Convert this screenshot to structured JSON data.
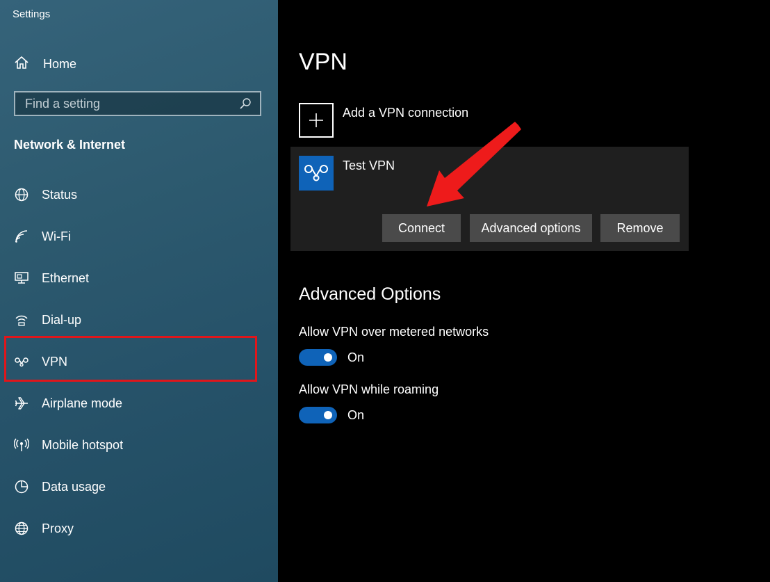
{
  "window": {
    "title": "Settings"
  },
  "sidebar": {
    "home_label": "Home",
    "search": {
      "placeholder": "Find a setting",
      "value": ""
    },
    "section_title": "Network & Internet",
    "items": [
      {
        "label": "Status",
        "icon": "globe-status-icon"
      },
      {
        "label": "Wi-Fi",
        "icon": "wifi-icon"
      },
      {
        "label": "Ethernet",
        "icon": "ethernet-icon"
      },
      {
        "label": "Dial-up",
        "icon": "dial-up-icon"
      },
      {
        "label": "VPN",
        "icon": "vpn-icon",
        "selected": true
      },
      {
        "label": "Airplane mode",
        "icon": "airplane-icon"
      },
      {
        "label": "Mobile hotspot",
        "icon": "hotspot-icon"
      },
      {
        "label": "Data usage",
        "icon": "data-usage-icon"
      },
      {
        "label": "Proxy",
        "icon": "proxy-globe-icon"
      }
    ]
  },
  "main": {
    "title": "VPN",
    "add_vpn_label": "Add a VPN connection",
    "vpn_connection": {
      "name": "Test VPN",
      "buttons": {
        "connect": "Connect",
        "advanced": "Advanced options",
        "remove": "Remove"
      }
    },
    "advanced": {
      "title": "Advanced Options",
      "options": [
        {
          "label": "Allow VPN over metered networks",
          "state": "On",
          "on": true
        },
        {
          "label": "Allow VPN while roaming",
          "state": "On",
          "on": true
        }
      ]
    }
  },
  "colors": {
    "accent": "#0f63b8",
    "highlight": "#e0161b",
    "button": "#4a4a4a",
    "card": "#1f1f1f"
  }
}
